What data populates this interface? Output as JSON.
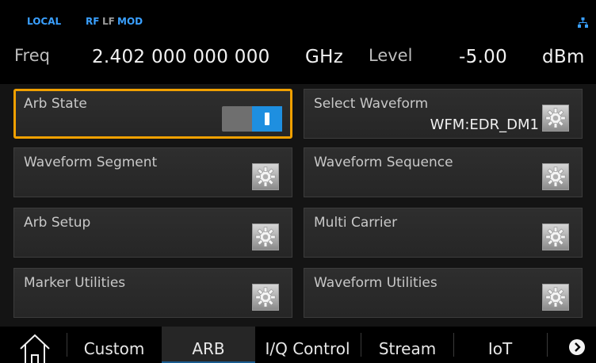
{
  "status": {
    "local": "LOCAL",
    "rf": "RF",
    "lf": "LF",
    "mod": "MOD",
    "network_icon": "network-icon"
  },
  "frequency": {
    "label": "Freq",
    "value": "2.402 000 000 000",
    "unit": "GHz"
  },
  "level": {
    "label": "Level",
    "value": "-5.00",
    "unit": "dBm"
  },
  "tiles": {
    "arb_state": {
      "label": "Arb State",
      "toggle_on": true
    },
    "select_waveform": {
      "label": "Select Waveform",
      "value": "WFM:EDR_DM1"
    },
    "waveform_segment": {
      "label": "Waveform Segment"
    },
    "waveform_sequence": {
      "label": "Waveform Sequence"
    },
    "arb_setup": {
      "label": "Arb Setup"
    },
    "multi_carrier": {
      "label": "Multi Carrier"
    },
    "marker_utilities": {
      "label": "Marker Utilities"
    },
    "waveform_utilities": {
      "label": "Waveform Utilities"
    }
  },
  "tabs": [
    {
      "label": "Custom",
      "active": false
    },
    {
      "label": "ARB",
      "active": true
    },
    {
      "label": "I/Q Control",
      "active": false
    },
    {
      "label": "Stream",
      "active": false
    },
    {
      "label": "IoT",
      "active": false
    }
  ],
  "colors": {
    "accent_selected": "#f0a000",
    "status_blue": "#3aa0ff",
    "toggle_on": "#1e8fe0"
  }
}
